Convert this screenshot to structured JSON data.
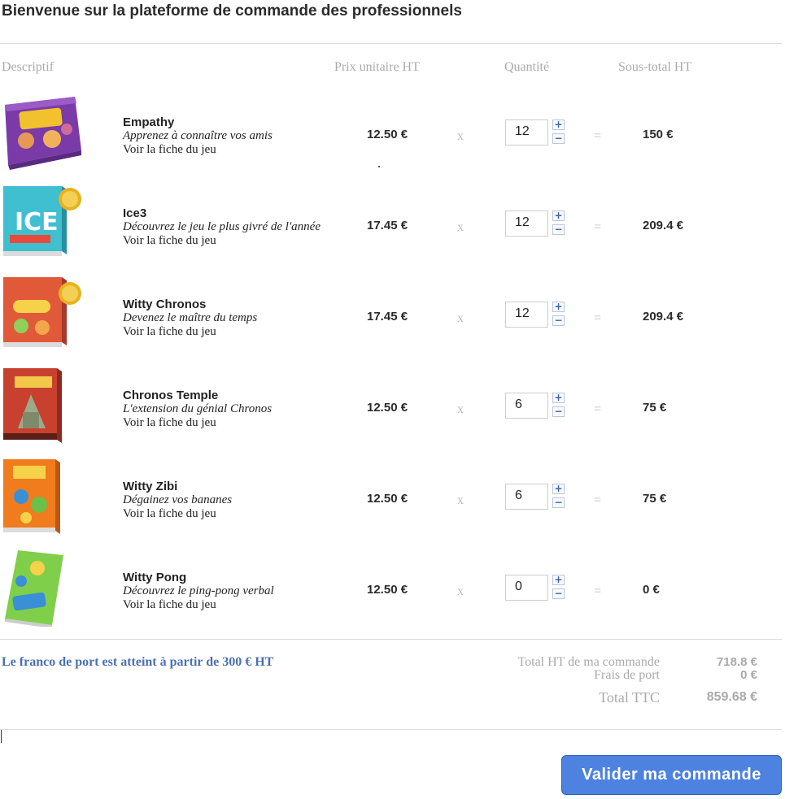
{
  "header": {
    "title": "Bienvenue sur la plateforme de commande des professionnels"
  },
  "columns": {
    "description": "Descriptif",
    "unit_price": "Prix unitaire HT",
    "quantity": "Quantité",
    "subtotal": "Sous-total HT"
  },
  "symbols": {
    "times": "x",
    "equals": "=",
    "plus": "+",
    "minus": "−"
  },
  "products": [
    {
      "name": "Empathy",
      "tagline": "Apprenez à connaître vos amis",
      "link": "Voir la fiche du jeu",
      "price": "12.50 €",
      "quantity": "12",
      "subtotal": "150 €"
    },
    {
      "name": "Ice3",
      "tagline": "Découvrez le jeu le plus givré de l'année",
      "link": "Voir la fiche du jeu",
      "price": "17.45 €",
      "quantity": "12",
      "subtotal": "209.4 €"
    },
    {
      "name": "Witty Chronos",
      "tagline": "Devenez le maître du temps",
      "link": "Voir la fiche du jeu",
      "price": "17.45 €",
      "quantity": "12",
      "subtotal": "209.4 €"
    },
    {
      "name": "Chronos Temple",
      "tagline": "L'extension du génial Chronos",
      "link": "Voir la fiche du jeu",
      "price": "12.50 €",
      "quantity": "6",
      "subtotal": "75 €"
    },
    {
      "name": "Witty Zibi",
      "tagline": "Dégainez vos bananes",
      "link": "Voir la fiche du jeu",
      "price": "12.50 €",
      "quantity": "6",
      "subtotal": "75 €"
    },
    {
      "name": "Witty Pong",
      "tagline": "Découvrez le ping-pong verbal",
      "link": "Voir la fiche du jeu",
      "price": "12.50 €",
      "quantity": "0",
      "subtotal": "0 €"
    }
  ],
  "footer": {
    "franco_note": "Le franco de port est atteint à partir de 300 € HT",
    "total_ht_label": "Total HT de ma commande",
    "total_ht_value": "718.8 €",
    "shipping_label": "Frais de port",
    "shipping_value": "0 €",
    "total_ttc_label": "Total TTC",
    "total_ttc_value": "859.68 €"
  },
  "actions": {
    "submit_label": "Valider ma commande"
  },
  "colors": {
    "accent": "#4d82e0",
    "link_blue": "#4a70b4",
    "muted": "#aaaaaa"
  }
}
